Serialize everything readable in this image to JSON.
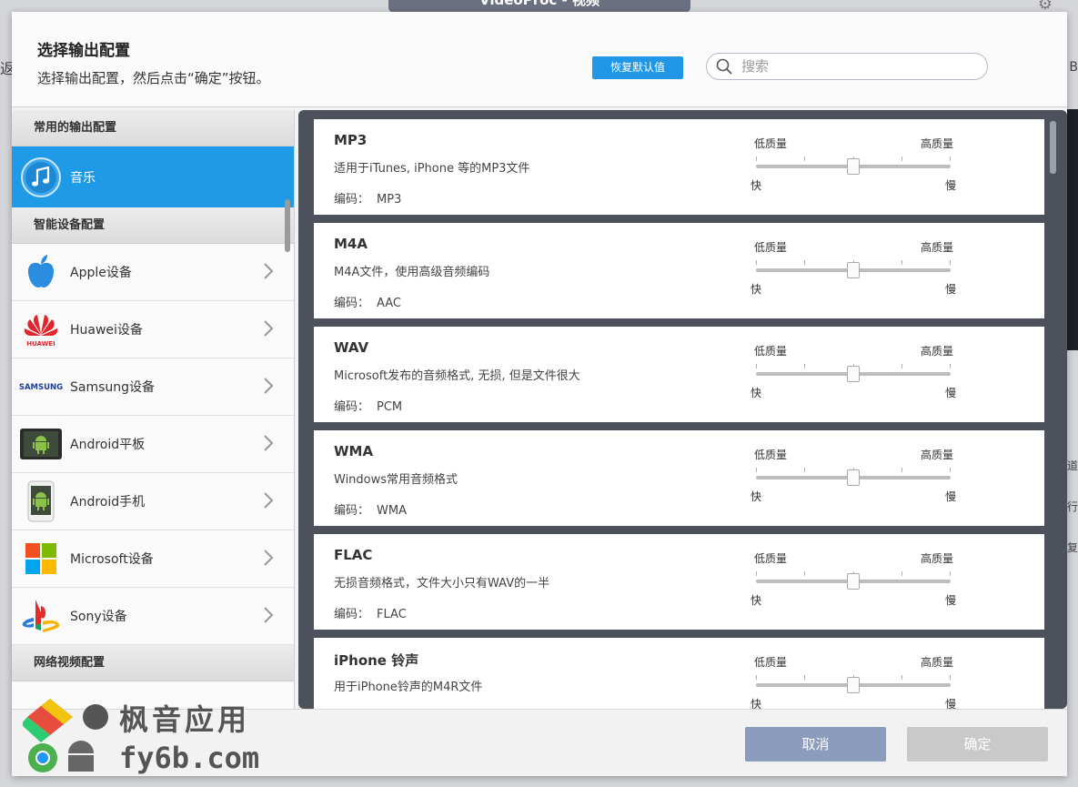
{
  "background": {
    "window_title": "VideoProc - 视频",
    "left_char": "返",
    "right_char": "B",
    "right_extras": [
      "道",
      "行",
      "复"
    ]
  },
  "header": {
    "title": "选择输出配置",
    "subtitle": "选择输出配置，然后点击“确定”按钮。",
    "reset_label": "恢复默认值",
    "search_placeholder": "搜索"
  },
  "sidebar": {
    "sections": {
      "common": "常用的输出配置",
      "smart": "智能设备配置",
      "web": "网络视频配置"
    },
    "selected": {
      "label": "音乐",
      "icon": "music-note-icon"
    },
    "devices": [
      {
        "label": "Apple设备",
        "icon": "apple-icon"
      },
      {
        "label": "Huawei设备",
        "icon": "huawei-icon",
        "brand": "HUAWEI"
      },
      {
        "label": "Samsung设备",
        "icon": "samsung-icon",
        "brand": "SAMSUNG"
      },
      {
        "label": "Android平板",
        "icon": "android-tablet-icon"
      },
      {
        "label": "Android手机",
        "icon": "android-phone-icon"
      },
      {
        "label": "Microsoft设备",
        "icon": "microsoft-icon"
      },
      {
        "label": "Sony设备",
        "icon": "playstation-icon"
      }
    ]
  },
  "quality_labels": {
    "low": "低质量",
    "high": "高质量",
    "fast": "快",
    "slow": "慢"
  },
  "codec_prefix": "编码：",
  "formats": [
    {
      "name": "MP3",
      "desc": "适用于iTunes, iPhone 等的MP3文件",
      "codec": "MP3",
      "quality": 0.5
    },
    {
      "name": "M4A",
      "desc": "M4A文件，使用高级音频编码",
      "codec": "AAC",
      "quality": 0.5
    },
    {
      "name": "WAV",
      "desc": "Microsoft发布的音频格式, 无损, 但是文件很大",
      "codec": "PCM",
      "quality": 0.5
    },
    {
      "name": "WMA",
      "desc": "Windows常用音频格式",
      "codec": "WMA",
      "quality": 0.5
    },
    {
      "name": "FLAC",
      "desc": "无损音频格式，文件大小只有WAV的一半",
      "codec": "FLAC",
      "quality": 0.5
    },
    {
      "name": "iPhone 铃声",
      "desc": "用于iPhone铃声的M4R文件",
      "codec": "",
      "quality": 0.5
    }
  ],
  "footer": {
    "cancel_label": "取消",
    "ok_label": "确定"
  },
  "watermark": {
    "line1": "枫音应用",
    "line2": "fy6b.com"
  },
  "colors": {
    "accent": "#1e9ae6",
    "panel_dark": "#4d515b",
    "cancel": "#8b9cbc",
    "ok_disabled": "#c9c9c9"
  }
}
